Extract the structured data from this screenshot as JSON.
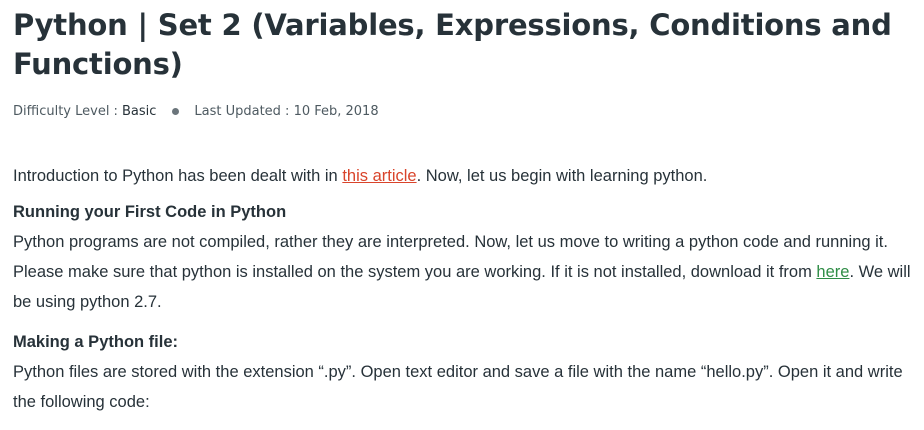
{
  "article": {
    "title": "Python | Set 2 (Variables, Expressions, Conditions and Functions)",
    "meta": {
      "difficulty_label": "Difficulty Level :",
      "difficulty_value": "Basic",
      "updated": "Last Updated : 10 Feb, 2018"
    },
    "intro": {
      "before": "Introduction to Python has been dealt with in ",
      "link_text": "this article",
      "after": ". Now, let us begin with learning python."
    },
    "section1": {
      "heading": "Running your First Code in Python",
      "before": "Python programs are not compiled, rather they are interpreted. Now, let us move to writing a python code and running it. Please make sure that python is installed on the system you are working. If it is not installed, download it from ",
      "link_text": "here",
      "after": ". We will be using python 2.7."
    },
    "section2": {
      "heading": "Making a Python file:",
      "text": "Python files are stored with the extension “.py”. Open text editor and save a file with the name “hello.py”. Open it and write the following code:"
    }
  },
  "colors": {
    "text": "#273239",
    "meta": "#4e5a61",
    "link_article": "#d9442b",
    "link_here": "#2f8d46"
  }
}
